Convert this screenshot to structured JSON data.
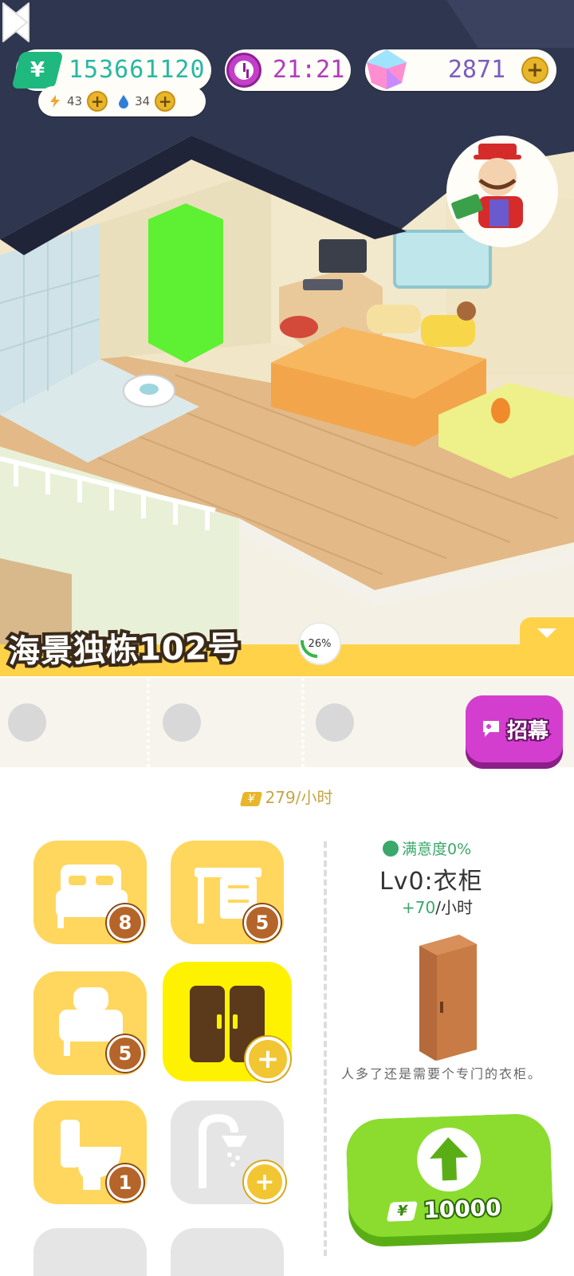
{
  "hud": {
    "money": "153661120",
    "money_symbol": "¥",
    "energy": "43",
    "water": "34",
    "time": "21:21",
    "gems": "2871"
  },
  "house": {
    "name": "海景独栋102号",
    "progress": "26%",
    "progress_value": 0.26
  },
  "recruit_label": "招幕",
  "income_text": "279/小时",
  "income_symbol": "¥",
  "categories": [
    {
      "name": "bed",
      "count": "8",
      "state": "owned"
    },
    {
      "name": "desk",
      "count": "5",
      "state": "owned"
    },
    {
      "name": "chair",
      "count": "5",
      "state": "owned"
    },
    {
      "name": "wardrobe",
      "count": "",
      "state": "selected"
    },
    {
      "name": "toilet",
      "count": "1",
      "state": "owned"
    },
    {
      "name": "shower",
      "count": "",
      "state": "locked"
    }
  ],
  "detail": {
    "satisfaction": "满意度0%",
    "name": "Lv0:衣柜",
    "rate_plus": "+70",
    "rate_unit": "/小时",
    "description": "人多了还是需要个专门的衣柜。",
    "cost": "10000",
    "cost_symbol": "¥"
  },
  "colors": {
    "title_band": "#ffd24a",
    "tile": "#ffd75e",
    "tile_selected": "#fff200",
    "upgrade": "#8bdc2e",
    "recruit": "#d43ecf"
  }
}
